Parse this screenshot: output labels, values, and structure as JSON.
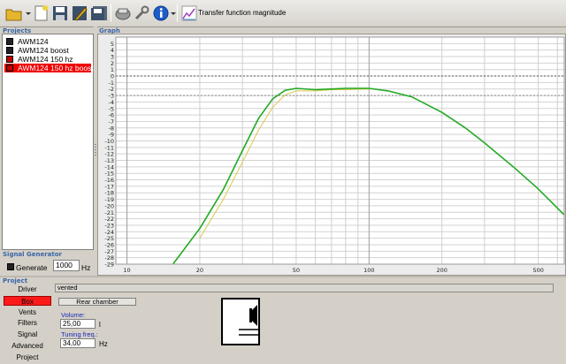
{
  "toolbar": {
    "buttons": [
      {
        "name": "open-folder-button",
        "icon": "folder-icon"
      },
      {
        "name": "new-file-button",
        "icon": "new-file-icon"
      },
      {
        "name": "save-button",
        "icon": "floppy-disk-icon"
      },
      {
        "name": "edit-button",
        "icon": "edit-icon"
      },
      {
        "name": "save-as-button",
        "icon": "floppy-disk-stack-icon"
      },
      {
        "name": "print-button",
        "icon": "printer-icon"
      },
      {
        "name": "tools-button",
        "icon": "wrench-icon"
      },
      {
        "name": "info-button",
        "icon": "info-icon"
      },
      {
        "name": "transfer-function-button",
        "icon": "chart-icon"
      }
    ],
    "transfer_label": "Transfer function magnitude"
  },
  "projects": {
    "section_label": "Projects",
    "items": [
      {
        "label": "AWM124",
        "checked_color": "#1a1a1a",
        "selected": false
      },
      {
        "label": "AWM124 boost",
        "checked_color": "#1a1a1a",
        "selected": false
      },
      {
        "label": "AWM124 150 hz",
        "checked_color": "#c00000",
        "selected": false
      },
      {
        "label": "AWM124 150 hz boost",
        "checked_color": "#c00000",
        "selected": true
      }
    ]
  },
  "graph": {
    "section_label": "Graph"
  },
  "signal_generator": {
    "section_label": "Signal Generator",
    "checkbox_label": "Generate",
    "frequency_value": "1000",
    "unit": "Hz"
  },
  "project_panel": {
    "section_label": "Project",
    "nav": [
      {
        "label": "Driver",
        "active": false
      },
      {
        "label": "Box",
        "active": true
      },
      {
        "label": "Vents",
        "active": false
      },
      {
        "label": "Filters",
        "active": false
      },
      {
        "label": "Signal",
        "active": false
      },
      {
        "label": "Advanced",
        "active": false
      },
      {
        "label": "Project",
        "active": false
      }
    ],
    "box_type": "vented",
    "rear_chamber_label": "Rear chamber",
    "volume_label": "Volume:",
    "volume_value": "25,00",
    "volume_unit": "l",
    "tuning_label": "Tuning freq.:",
    "tuning_value": "34,00",
    "tuning_unit": "Hz"
  },
  "colors": {
    "accent_red": "#ff1a1a",
    "curve_green": "#22aa22",
    "reference_yellow": "#c8c832"
  },
  "chart_data": {
    "type": "line",
    "x_scale": "log",
    "xlim": [
      9,
      640
    ],
    "ylim": [
      -29,
      6
    ],
    "x_ticks": [
      10,
      20,
      50,
      100,
      200,
      500
    ],
    "y_ticks": [
      5,
      4,
      3,
      2,
      1,
      0,
      -1,
      -2,
      -3,
      -4,
      -5,
      -6,
      -7,
      -8,
      -9,
      -10,
      -11,
      -12,
      -13,
      -14,
      -15,
      -16,
      -17,
      -18,
      -19,
      -20,
      -21,
      -22,
      -23,
      -24,
      -25,
      -26,
      -27,
      -28,
      -29
    ],
    "reference_lines": [
      0,
      -3
    ],
    "grid": true,
    "series": [
      {
        "color": "#22aa22",
        "x": [
          15.5,
          20,
          25,
          30,
          35,
          40,
          45,
          50,
          60,
          70,
          80,
          100,
          120,
          150,
          200,
          250,
          300,
          400,
          500,
          640
        ],
        "y": [
          -29,
          -23.5,
          -17.5,
          -11.5,
          -6.5,
          -3.5,
          -2.2,
          -1.9,
          -2.1,
          -2.0,
          -1.9,
          -1.9,
          -2.3,
          -3.2,
          -5.6,
          -8.0,
          -10.3,
          -14.2,
          -17.4,
          -21.4
        ]
      },
      {
        "color": "#d6c84a",
        "x": [
          20,
          25,
          30,
          35,
          40,
          45,
          50,
          60,
          70,
          80,
          100
        ],
        "y": [
          -25,
          -19,
          -13.3,
          -8.3,
          -4.8,
          -2.9,
          -2.3,
          -2.3,
          -2.1,
          -2.1,
          -2.0
        ]
      }
    ]
  }
}
